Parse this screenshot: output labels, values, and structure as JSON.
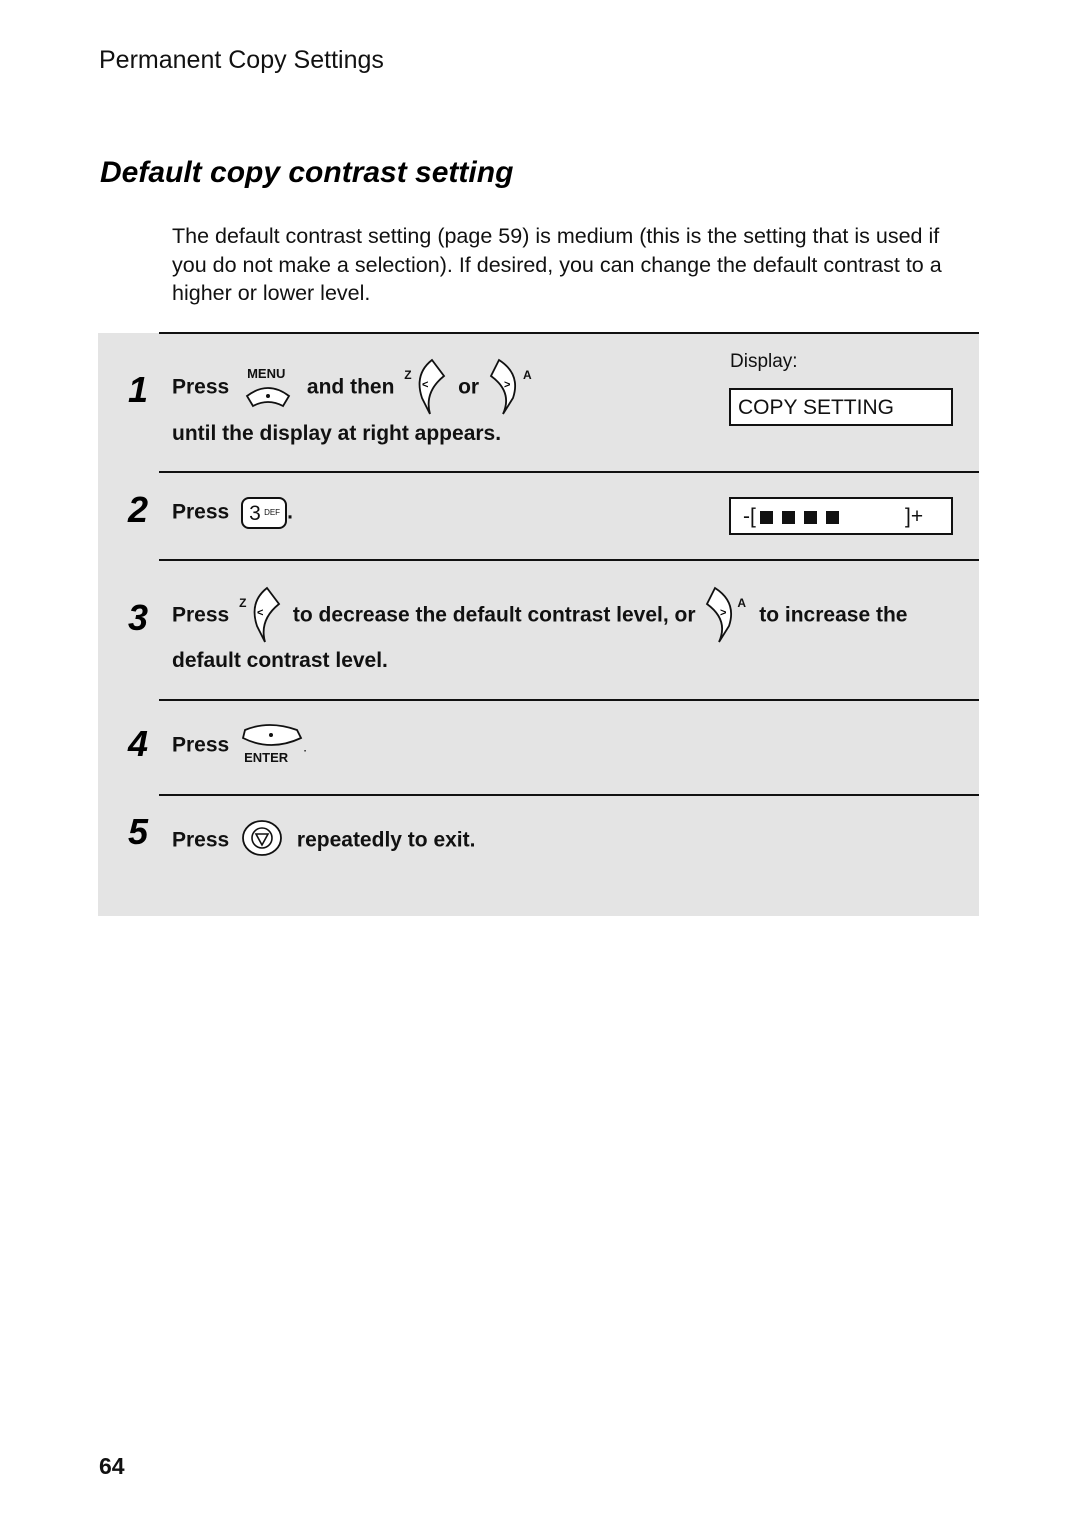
{
  "running_head": "Permanent Copy Settings",
  "section_title": "Default copy contrast setting",
  "intro": "The default contrast setting (page 59) is medium (this is the setting that is used if you do not make a selection). If desired, you can change the default contrast to a higher or lower level.",
  "display_label": "Display:",
  "steps": [
    {
      "number": "1",
      "press": "Press",
      "menu_key": "MENU",
      "and_then": "and then",
      "left_key_letter": "Z",
      "or": "or",
      "right_key_letter": "A",
      "line2": "until the display at right appears.",
      "display": "COPY SETTING"
    },
    {
      "number": "2",
      "press": "Press",
      "key_digit": "3",
      "key_letters": "DEF",
      "suffix": ".",
      "display_left": "-[",
      "display_right": "]+",
      "contrast_level_blocks": 4
    },
    {
      "number": "3",
      "press": "Press",
      "left_key_letter": "Z",
      "mid_text": "to decrease the default contrast level, or",
      "right_key_letter": "A",
      "end_text": "to increase the",
      "line2": "default contrast level."
    },
    {
      "number": "4",
      "press": "Press",
      "enter_key": "ENTER",
      "suffix": "."
    },
    {
      "number": "5",
      "press": "Press",
      "after": "repeatedly to exit."
    }
  ],
  "page_number": "64"
}
